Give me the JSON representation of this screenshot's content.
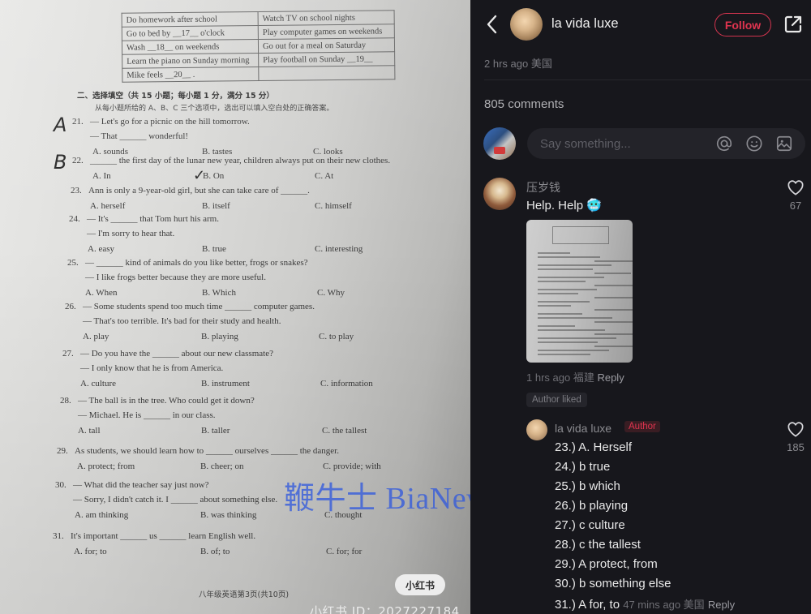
{
  "photo": {
    "table": [
      [
        "Do homework after school",
        "Watch TV on school nights"
      ],
      [
        "Go to bed by __17__ o'clock",
        "Play computer games on weekends"
      ],
      [
        "Wash __18__ on weekends",
        "Go out for a meal on Saturday"
      ],
      [
        "Learn the piano on Sunday morning",
        "Play football on Sunday __19__"
      ],
      [
        "Mike feels __20__ .",
        ""
      ]
    ],
    "section_title": "二、选择填空（共 15 小题；每小题 1 分，满分 15 分）",
    "section_instruction": "从每小题所给的 A、B、C 三个选项中，选出可以填入空白处的正确答案。",
    "questions": [
      {
        "num": "21.",
        "lines": [
          "— Let's go for a picnic on the hill tomorrow.",
          "— That ______ wonderful!"
        ],
        "options": [
          "A. sounds",
          "B. tastes",
          "C. looks"
        ],
        "handwritten": "A"
      },
      {
        "num": "22.",
        "lines": [
          "______ the first day of the lunar new year, children always put on their new clothes."
        ],
        "options": [
          "A. In",
          "B. On",
          "C. At"
        ],
        "handwritten": "B"
      },
      {
        "num": "23.",
        "lines": [
          "Ann is only a 9-year-old girl, but she can take care of ______."
        ],
        "options": [
          "A. herself",
          "B. itself",
          "C. himself"
        ]
      },
      {
        "num": "24.",
        "lines": [
          "— It's ______ that Tom hurt his arm.",
          "— I'm sorry to hear that."
        ],
        "options": [
          "A. easy",
          "B. true",
          "C. interesting"
        ]
      },
      {
        "num": "25.",
        "lines": [
          "— ______ kind of animals do you like better, frogs or snakes?",
          "— I like frogs better because they are more useful."
        ],
        "options": [
          "A. When",
          "B. Which",
          "C. Why"
        ]
      },
      {
        "num": "26.",
        "lines": [
          "— Some students spend too much time ______ computer games.",
          "— That's too terrible. It's bad for their study and health."
        ],
        "options": [
          "A. play",
          "B. playing",
          "C. to play"
        ]
      },
      {
        "num": "27.",
        "lines": [
          "— Do you have the ______ about our new classmate?",
          "— I only know that he is from America."
        ],
        "options": [
          "A. culture",
          "B. instrument",
          "C. information"
        ]
      },
      {
        "num": "28.",
        "lines": [
          "— The ball is in the tree. Who could get it down?",
          "— Michael. He is ______ in our class."
        ],
        "options": [
          "A. tall",
          "B. taller",
          "C. the tallest"
        ]
      },
      {
        "num": "29.",
        "lines": [
          "As students, we should learn how to ______ ourselves ______ the danger."
        ],
        "options": [
          "A. protect; from",
          "B. cheer; on",
          "C. provide; with"
        ]
      },
      {
        "num": "30.",
        "lines": [
          "— What did the teacher say just now?",
          "— Sorry, I didn't catch it. I ______ about something else."
        ],
        "options": [
          "A. am thinking",
          "B. was thinking",
          "C. thought"
        ]
      },
      {
        "num": "31.",
        "lines": [
          "It's important ______ us ______ learn English well."
        ],
        "options": [
          "A. for; to",
          "B. of; to",
          "C. for; for"
        ]
      }
    ],
    "page_footer": "八年级英语第3页(共10页)",
    "xhs_badge": "小红书",
    "xhs_id": "小红书 ID：2027227184",
    "watermark": "鞭牛士 BiaNews"
  },
  "header": {
    "back_icon": "chevron-left-icon",
    "username": "la vida luxe",
    "follow_label": "Follow",
    "share_icon": "external-share-icon",
    "accent_color": "#e0344f"
  },
  "post": {
    "time": "2 hrs ago 美国",
    "comment_count": "805 comments"
  },
  "composer": {
    "placeholder": "Say something...",
    "icons": [
      "at-icon",
      "emoji-icon",
      "image-icon"
    ]
  },
  "comments": [
    {
      "user": "压岁钱",
      "text": "Help. Help 🥶",
      "likes": "67",
      "meta_time": "1 hrs ago 福建",
      "reply_label": "Reply",
      "has_image": true,
      "badge": "Author liked",
      "replies": [
        {
          "user": "la vida luxe",
          "badge": "Author",
          "likes": "185",
          "lines": [
            "23.) A. Herself",
            "24.) b true",
            "25.) b which",
            "26.) b playing",
            "27.) c culture",
            "28.) c the tallest",
            "29.) A protect, from",
            "30.) b something else",
            "31.) A for, to"
          ],
          "meta_time": "47 mins ago 美国",
          "reply_label": "Reply"
        }
      ]
    }
  ]
}
